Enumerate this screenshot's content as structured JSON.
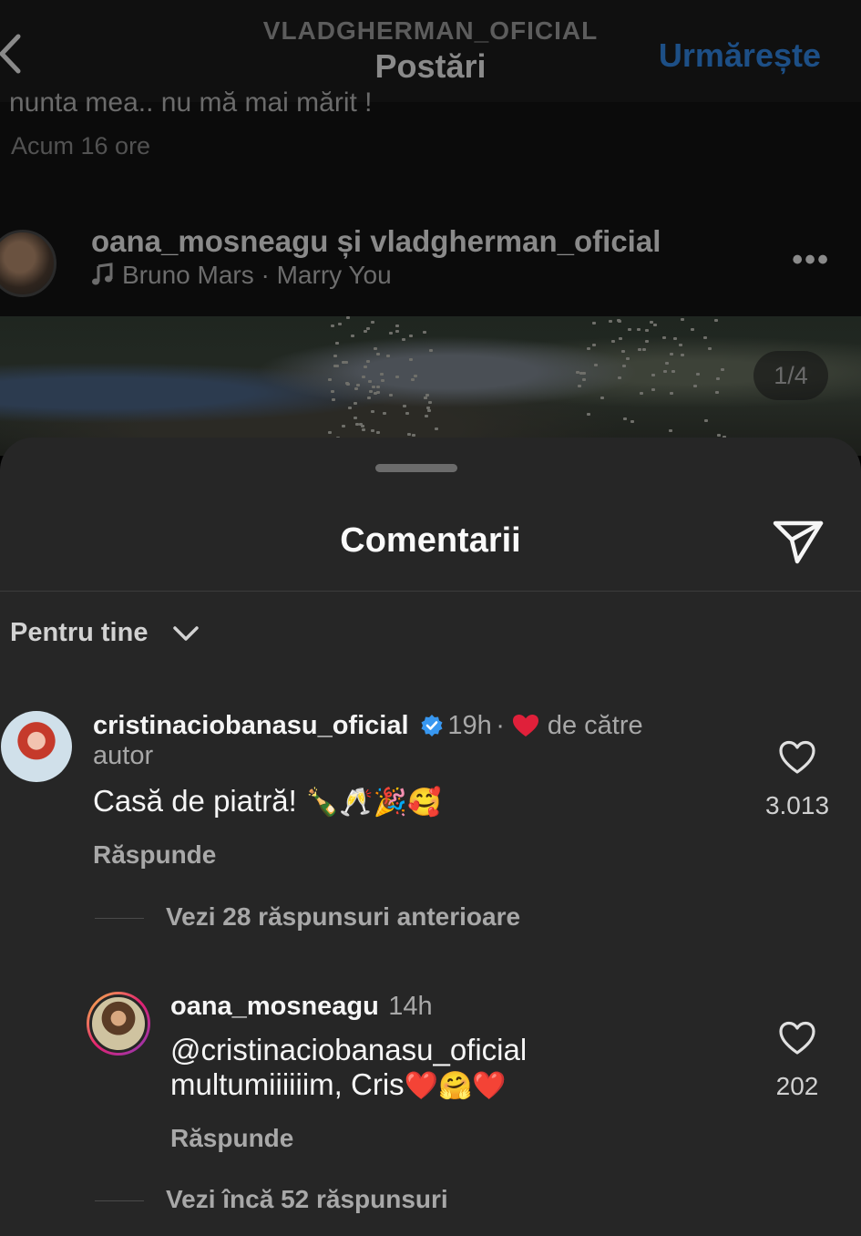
{
  "header": {
    "username": "VLADGHERMAN_OFICIAL",
    "title": "Postări",
    "follow_label": "Urmărește"
  },
  "post": {
    "caption_cut": "nunta mea.. nu mă mai mărit !",
    "time": "Acum 16 ore",
    "authors": "oana_mosneagu și vladgherman_oficial",
    "music": "Bruno Mars · Marry You",
    "more": "•••",
    "image_counter": "1/4"
  },
  "sheet": {
    "title": "Comentarii",
    "filter_label": "Pentru tine"
  },
  "comments": [
    {
      "username": "cristinaciobanasu_oficial",
      "time": "19h",
      "separator": "·",
      "liked_by": "de către",
      "liked_by_2": "autor",
      "text": "Casă de piatră!",
      "emojis": "🍾🥂🎉🥰",
      "reply_label": "Răspunde",
      "likes": "3.013",
      "more_replies": "Vezi 28 răspunsuri anterioare"
    },
    {
      "username": "oana_mosneagu",
      "time": "14h",
      "mention": "@cristinaciobanasu_oficial",
      "text": "multumiiiiiim, Cris",
      "emojis": "❤️🤗❤️",
      "reply_label": "Răspunde",
      "likes": "202",
      "more_replies": "Vezi încă 52 răspunsuri"
    }
  ],
  "colors": {
    "sheet_bg": "#262626",
    "follow": "#1d4f86",
    "verified": "#3897f0",
    "heart_red": "#e0203a"
  },
  "icons": [
    "back-icon",
    "music-icon",
    "share-icon",
    "chevron-down-icon",
    "verified-icon",
    "heart-icon"
  ]
}
